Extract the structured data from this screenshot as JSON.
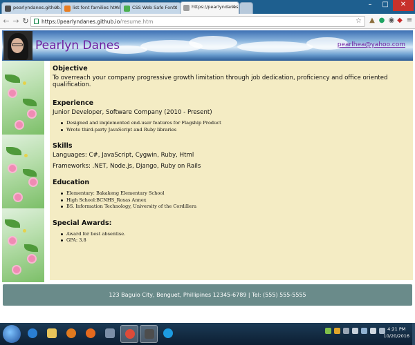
{
  "browser": {
    "tabs": [
      {
        "label": "pearlyndanes.github.io",
        "favicon_color": "#4a4a4a",
        "active": false
      },
      {
        "label": "list font families html - W",
        "favicon_color": "#e77d22",
        "active": false
      },
      {
        "label": "CSS Web Safe Fonts",
        "favicon_color": "#4caf50",
        "active": false
      },
      {
        "label": "https://pearlyndanes.gi",
        "favicon_color": "#9e9e9e",
        "active": true
      }
    ],
    "url_host": "https://pearlyndanes.github.io",
    "url_path": "/resume.htm"
  },
  "header": {
    "name": "Pearlyn Danes",
    "email": "pearlhea@yahoo.com"
  },
  "sections": {
    "objective": {
      "title": "Objective",
      "text": "To overreach your company progressive growth limitation through job dedication, proficiency and office oriented qualification."
    },
    "experience": {
      "title": "Experience",
      "role": "Junior Developer, Software Company (2010 - Present)",
      "items": [
        "Designed and implemented end-user features for Flagship Product",
        "Wrote third-party JavaScript and Ruby libraries"
      ]
    },
    "skills": {
      "title": "Skills",
      "languages": "Languages: C#, JavaScript, Cygwin, Ruby, Html",
      "frameworks": "Frameworks: .NET, Node.js, Django, Ruby on Rails"
    },
    "education": {
      "title": "Education",
      "items": [
        "Elementary: Bakakeng Elementary School",
        "High School:BCNHS_Roxas Annex",
        "BS. Information Technology, University of the Cordillera"
      ]
    },
    "awards": {
      "title": "Special Awards:",
      "items": [
        "Award for best absentise.",
        "GPA: 3.8"
      ]
    }
  },
  "footer": {
    "text": "123 Baguio City, Benguet, Phillipines 12345-6789 | Tel: (555) 555-5555"
  },
  "taskbar": {
    "time": "4:21 PM",
    "date": "10/20/2016"
  }
}
